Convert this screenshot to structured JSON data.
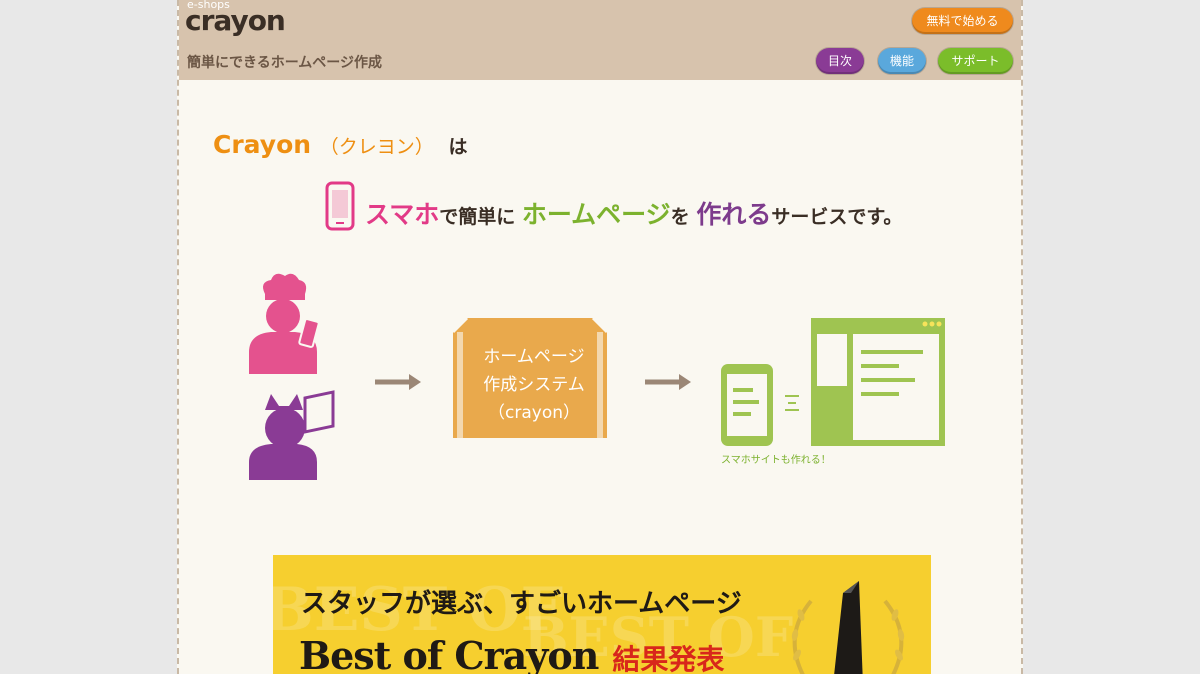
{
  "header": {
    "logo_small": "e-shops",
    "logo_main": "crayon",
    "tagline": "簡単にできるホームページ作成",
    "buttons": {
      "start": "無料で始める",
      "toc": "目次",
      "features": "機能",
      "support": "サポート"
    }
  },
  "hero": {
    "brand": "Crayon",
    "brand_kana": "（クレヨン）",
    "brand_particle": "は",
    "sub": {
      "part1": "スマホ",
      "part2": "で簡単に",
      "part3": "ホームページ",
      "part4": "を",
      "part5": "作れる",
      "part6": "サービスです。"
    }
  },
  "diagram": {
    "box_lines": [
      "ホームページ",
      "作成システム",
      "（crayon）"
    ],
    "caption": "スマホサイトも作れる！"
  },
  "banner": {
    "line1": "スタッフが選ぶ、すごいホームページ",
    "line2": "Best of Crayon",
    "result": "結果発表"
  },
  "colors": {
    "header_bg": "#d7c3ad",
    "orange": "#ee8f12",
    "pink": "#e23a87",
    "green": "#7cb22e",
    "purple": "#7d3b8c",
    "blue": "#5aa8dc",
    "banner_yellow": "#f6cf2f"
  }
}
